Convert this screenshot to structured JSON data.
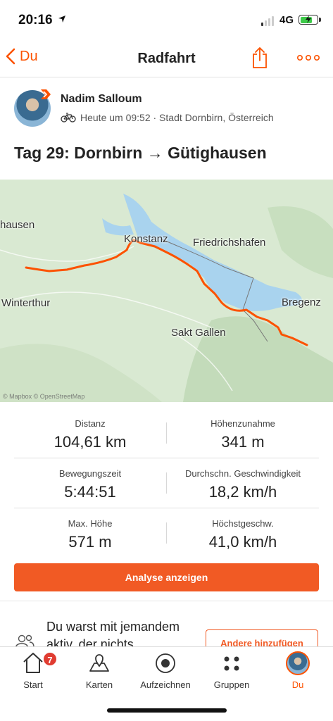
{
  "status_bar": {
    "time": "20:16",
    "network": "4G",
    "battery_level": 0.6,
    "battery_charging": true,
    "signal_bars_active": 1
  },
  "nav": {
    "back_label": "Du",
    "title": "Radfahrt",
    "share_icon": "share-icon",
    "more_icon": "more-dots-icon"
  },
  "author": {
    "name": "Nadim Salloum",
    "meta": "Heute um 09:52 · Stadt Dornbirn, Österreich",
    "activity_icon": "bike-icon"
  },
  "activity_title": "Tag 29: Dornbirn → Gütighausen",
  "map": {
    "labels": [
      "hausen",
      "Konstanz",
      "Friedrichshafen",
      "Winterthur",
      "Bregenz",
      "Sakt Gallen"
    ],
    "attribution": "© Mapbox © OpenStreetMap",
    "route_color": "#fc5200"
  },
  "stats": [
    {
      "label": "Distanz",
      "value": "104,61 km"
    },
    {
      "label": "Höhenzunahme",
      "value": "341 m"
    },
    {
      "label": "Bewegungszeit",
      "value": "5:44:51"
    },
    {
      "label": "Durchschn. Geschwindigkeit",
      "value": "18,2 km/h"
    },
    {
      "label": "Max. Höhe",
      "value": "571 m"
    },
    {
      "label": "Höchstgeschw.",
      "value": "41,0 km/h"
    }
  ],
  "analyse_button": "Analyse anzeigen",
  "with_section": {
    "text": "Du warst mit jemandem aktiv, der nichts",
    "button": "Andere hinzufügen"
  },
  "tabbar": {
    "items": [
      {
        "label": "Start",
        "icon": "home-icon",
        "badge": "7"
      },
      {
        "label": "Karten",
        "icon": "map-icon"
      },
      {
        "label": "Aufzeichnen",
        "icon": "record-icon"
      },
      {
        "label": "Gruppen",
        "icon": "groups-icon"
      },
      {
        "label": "Du",
        "icon": "avatar",
        "active": true
      }
    ]
  },
  "colors": {
    "accent": "#fc5200",
    "button": "#f15a24",
    "lake": "#a9d3ee"
  }
}
